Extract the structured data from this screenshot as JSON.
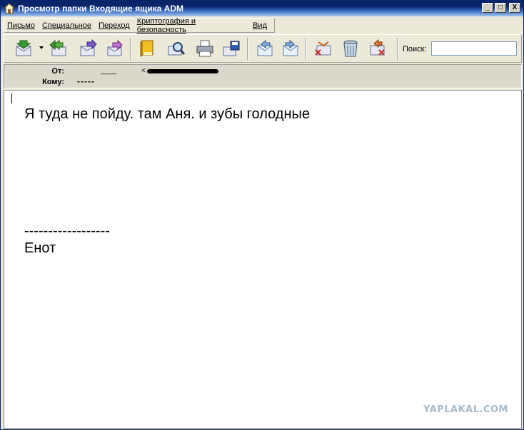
{
  "window": {
    "title": "Просмотр папки Входящие ящика ADM",
    "minimize": "_",
    "maximize": "□",
    "close": "X"
  },
  "menu": {
    "items": [
      "Письмо",
      "Специальное",
      "Переход",
      "Криптография и безопасность",
      "Вид"
    ]
  },
  "toolbar": {
    "search_label": "Поиск:",
    "search_value": "",
    "icons": [
      "get-mail-icon",
      "reply-all-icon",
      "forward-icon",
      "redirect-icon",
      "address-book-icon",
      "find-icon",
      "print-icon",
      "save-icon",
      "prev-message-icon",
      "next-message-icon",
      "delete-message-icon",
      "trash-icon",
      "delete-permanent-icon"
    ]
  },
  "header": {
    "from_label": "От:",
    "from_name": "____",
    "from_email_prefix": "<",
    "to_label": "Кому:",
    "to_value": "-----"
  },
  "message": {
    "line1": "Я туда не пойду. там Аня. и зубы голодные",
    "separator": "------------------",
    "signature": "Енот"
  },
  "watermark": "YAPLAKAL.COM",
  "colors": {
    "titlebar": "#0a246a",
    "chrome": "#ece9d8",
    "watermark": "#a8bccc"
  }
}
